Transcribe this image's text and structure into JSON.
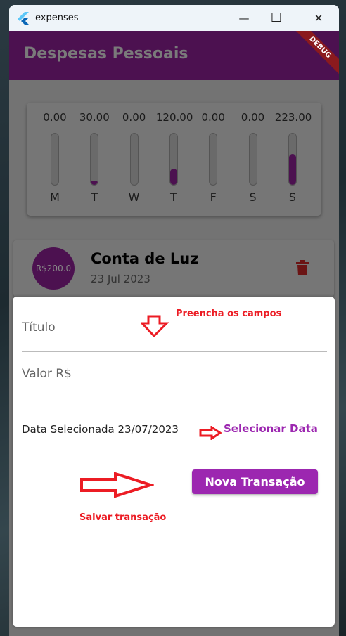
{
  "window": {
    "title": "expenses",
    "minimize": "—",
    "maximize": "☐",
    "close": "✕"
  },
  "appbar": {
    "title": "Despesas Pessoais",
    "debug_banner": "DEBUG"
  },
  "chart_data": {
    "type": "bar",
    "categories": [
      "M",
      "T",
      "W",
      "T",
      "F",
      "S",
      "S"
    ],
    "labels": [
      "0.00",
      "30.00",
      "0.00",
      "120.00",
      "0.00",
      "0.00",
      "223.00"
    ],
    "values": [
      0,
      30,
      0,
      120,
      0,
      0,
      223
    ],
    "total": 373,
    "fill_color": "#4c1150"
  },
  "transactions": [
    {
      "value": "R$200.0",
      "title": "Conta de Luz",
      "date": "23 Jul 2023"
    }
  ],
  "form": {
    "title_label": "Título",
    "value_label": "Valor R$",
    "date_label": "Data Selecionada 23/07/2023",
    "select_date": "Selecionar Data",
    "submit": "Nova Transação"
  },
  "annotations": {
    "fill_fields": "Preencha os campos",
    "save": "Salvar transação",
    "color": "#ec1c24"
  }
}
